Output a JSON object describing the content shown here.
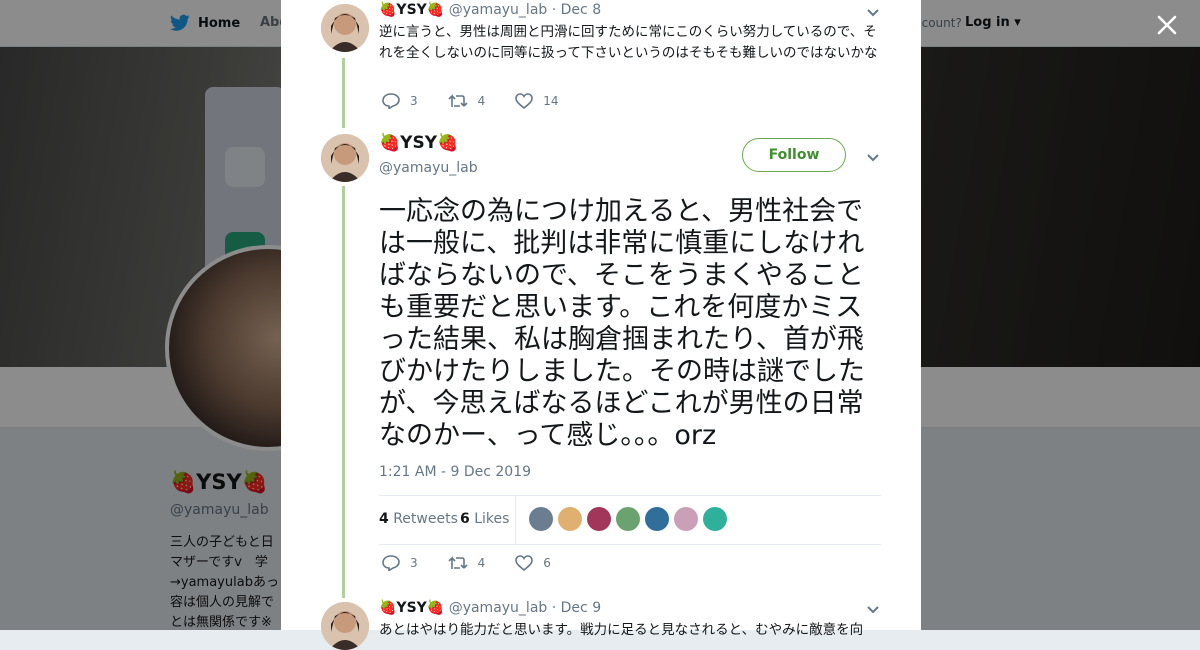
{
  "nav": {
    "home_label": "Home",
    "about_label": "Abo",
    "account_label": "ccount?",
    "login_label": "Log in"
  },
  "profile": {
    "display_name": "🍓YSY🍓",
    "handle": "@yamayu_lab",
    "bio": "三人の子どもと日\nマザーですv　学\n→yamayulabあっ\n容は個人の見解で\nとは無関係です※"
  },
  "tweet_prev": {
    "name": "🍓YSY🍓",
    "handle": "@yamayu_lab",
    "date": "· Dec 8",
    "text": "逆に言うと、男性は周囲と円滑に回すために常にこのくらい努力しているので、それを全くしないのに同等に扱って下さいというのはそもそも難しいのではないかな",
    "replies": "3",
    "retweets": "4",
    "likes": "14"
  },
  "tweet_main": {
    "name": "🍓YSY🍓",
    "handle": "@yamayu_lab",
    "follow_label": "Follow",
    "text": "一応念の為につけ加えると、男性社会では一般に、批判は非常に慎重にしなければならないので、そこをうまくやることも重要だと思います。これを何度かミスった結果、私は胸倉掴まれたり、首が飛びかけたりしました。その時は謎でしたが、今思えばなるほどこれが男性の日常なのかー、って感じ。。。orz",
    "timestamp": "1:21 AM - 9 Dec 2019",
    "retweets_count": "4",
    "retweets_label": "Retweets",
    "likes_count": "6",
    "likes_label": "Likes",
    "replies": "3",
    "retweets": "4",
    "likes": "6",
    "liker_colors": [
      "#6b7d91",
      "#e0b070",
      "#a2355a",
      "#6aa36f",
      "#2f6f9a",
      "#c9a0b8",
      "#2fb09a"
    ]
  },
  "tweet_next": {
    "name": "🍓YSY🍓",
    "handle": "@yamayu_lab",
    "date": "· Dec 9",
    "text": "あとはやはり能力だと思います。戦力に足ると見なされると、むやみに敵意を向"
  },
  "colors": {
    "accent_green": "#3f8f2f",
    "thread_line": "#aed0a0",
    "muted": "#657786"
  }
}
